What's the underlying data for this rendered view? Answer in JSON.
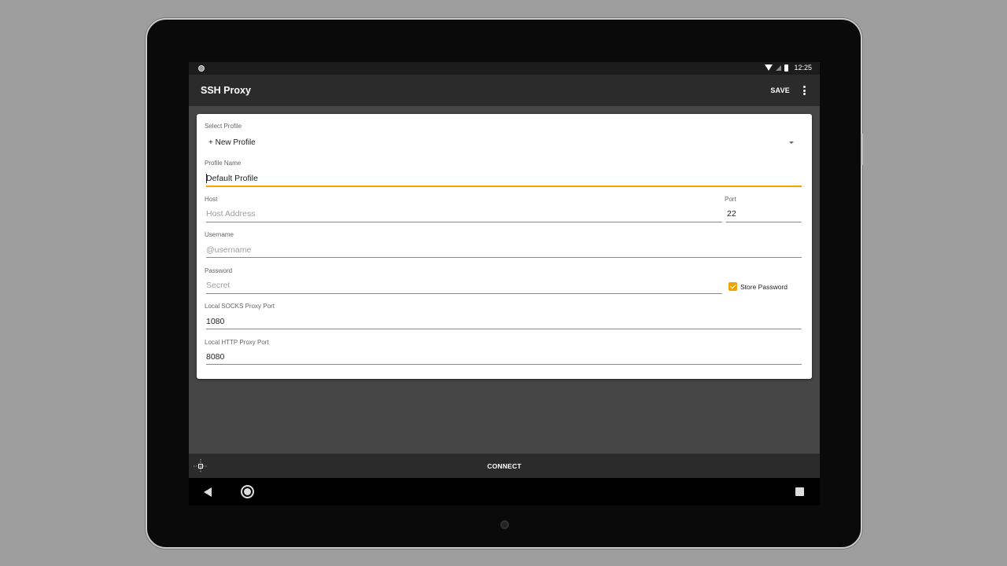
{
  "statusbar": {
    "time": "12:25",
    "icons": [
      "wifi-icon",
      "signal-icon",
      "battery-icon"
    ]
  },
  "appbar": {
    "title": "SSH Proxy",
    "save_label": "SAVE",
    "menu_icon": "overflow-menu-icon"
  },
  "form": {
    "select_profile": {
      "label": "Select Profile",
      "value": "+ New Profile"
    },
    "profile_name": {
      "label": "Profile Name",
      "value": "Default Profile"
    },
    "host": {
      "label": "Host",
      "placeholder": "Host Address"
    },
    "port": {
      "label": "Port",
      "value": "22"
    },
    "username": {
      "label": "Username",
      "placeholder": "@username"
    },
    "password": {
      "label": "Password",
      "placeholder": "Secret"
    },
    "store_password": {
      "label": "Store Password",
      "checked": true
    },
    "socks_port": {
      "label": "Local SOCKS Proxy Port",
      "value": "1080"
    },
    "http_port": {
      "label": "Local HTTP Proxy Port",
      "value": "8080"
    }
  },
  "bottombar": {
    "connect_label": "CONNECT",
    "icon": "crosshair-icon"
  },
  "colors": {
    "accent": "#f0a500",
    "appbar": "#2b2b2b",
    "background": "#464646"
  }
}
